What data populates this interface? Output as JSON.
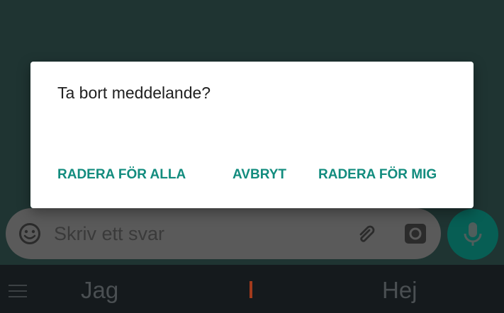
{
  "composer": {
    "placeholder": "Skriv ett svar",
    "icons": [
      "emoji-icon",
      "paperclip-icon",
      "camera-icon"
    ]
  },
  "mic_button": {
    "icon": "microphone-icon",
    "color": "#075e54"
  },
  "keyboard": {
    "suggestions": [
      "Jag",
      "Hej"
    ],
    "menu_icon": "hamburger-menu-icon"
  },
  "dialog": {
    "message": "Ta bort meddelande?",
    "actions": {
      "delete_for_all": "RADERA FÖR ALLA",
      "cancel": "AVBRYT",
      "delete_for_me": "RADERA FÖR MIG"
    },
    "accent_color": "#128c7e"
  }
}
